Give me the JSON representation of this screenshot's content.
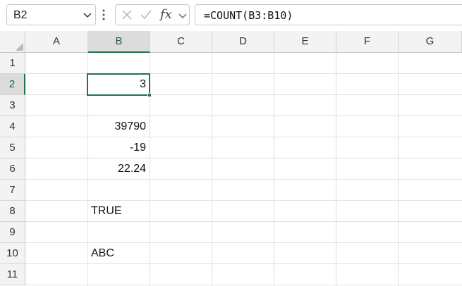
{
  "formula_bar": {
    "name_box": "B2",
    "fx_label": "fx",
    "formula": "=COUNT(B3:B10)"
  },
  "columns": [
    "A",
    "B",
    "C",
    "D",
    "E",
    "F",
    "G"
  ],
  "rows": [
    "1",
    "2",
    "3",
    "4",
    "5",
    "6",
    "7",
    "8",
    "9",
    "10",
    "11"
  ],
  "selection": {
    "column": "B",
    "row": "2"
  },
  "cells": {
    "B2": "3",
    "B4": "39790",
    "B5": "-19",
    "B6": "22.24",
    "B8": "TRUE",
    "B10": "ABC"
  },
  "colors": {
    "accent": "#217346",
    "header_bg": "#f3f3f3",
    "header_selected_bg": "#dcdcdc",
    "gridline": "#e1e1e1"
  }
}
